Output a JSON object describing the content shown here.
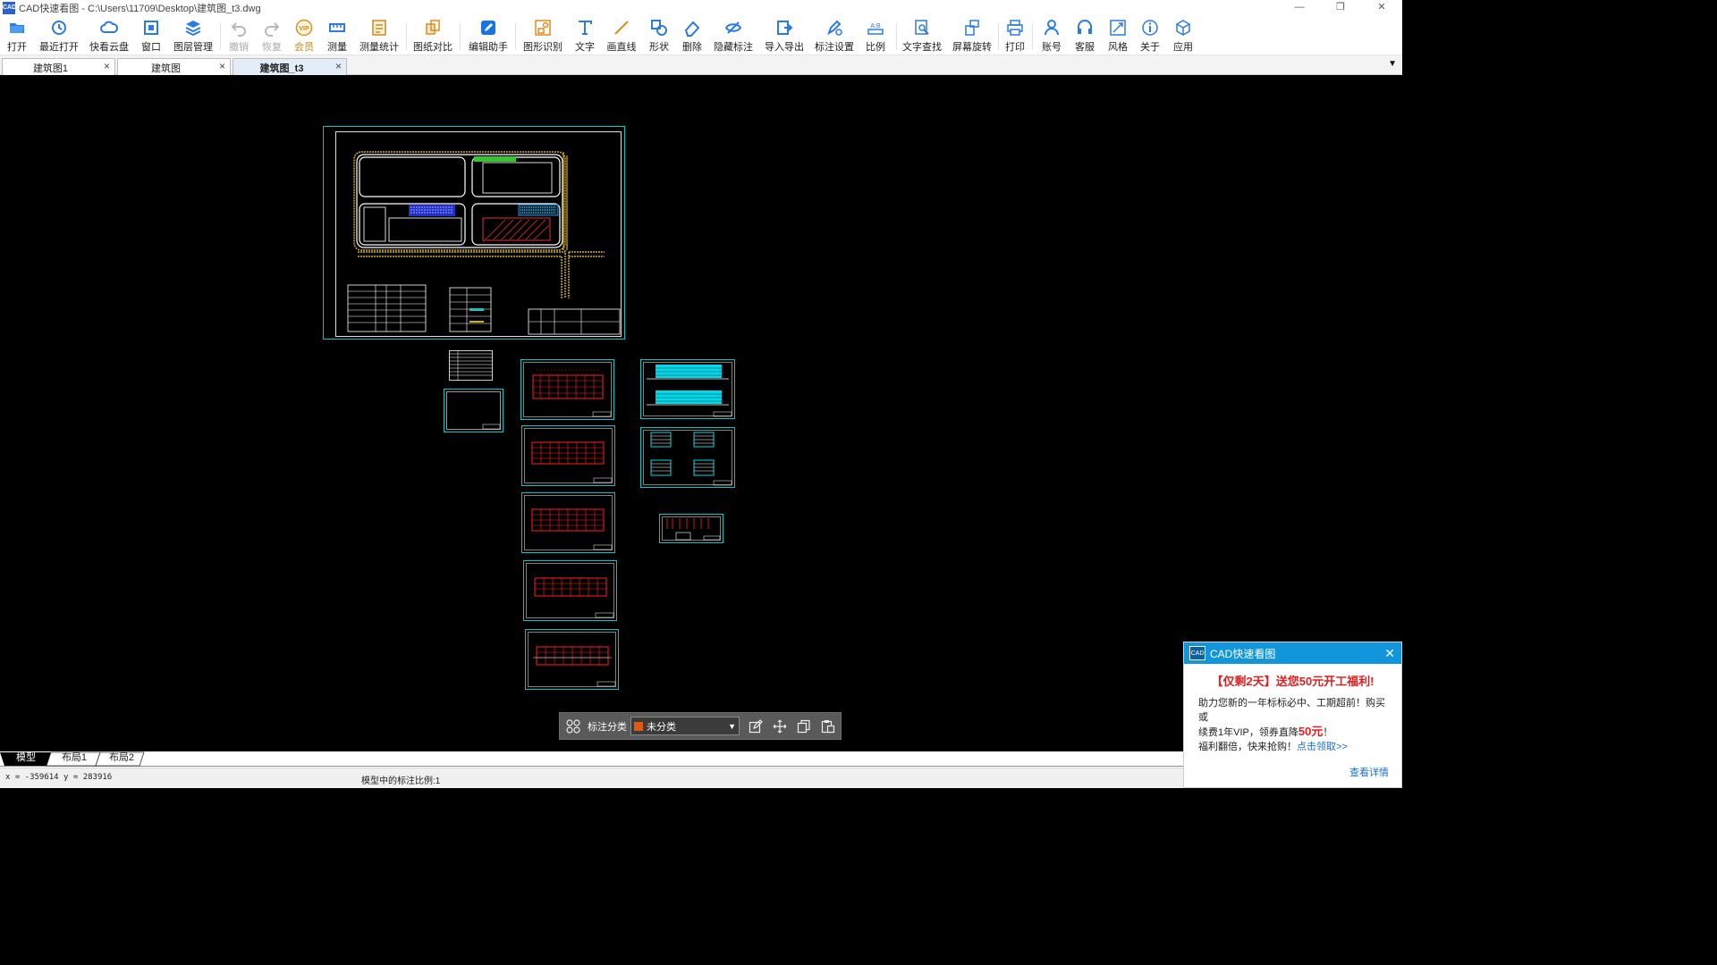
{
  "window": {
    "title": "CAD快速看图 - C:\\Users\\11709\\Desktop\\建筑图_t3.dwg",
    "app_icon_text": "CAD",
    "minimize": "—",
    "maximize": "❐",
    "close": "✕"
  },
  "toolbar": {
    "items": [
      {
        "id": "open",
        "label": "打开",
        "icon": "folder-open-icon"
      },
      {
        "id": "recent",
        "label": "最近打开",
        "icon": "history-icon"
      },
      {
        "id": "cloud",
        "label": "快看云盘",
        "icon": "cloud-icon"
      },
      {
        "id": "window",
        "label": "窗口",
        "icon": "window-fit-icon"
      },
      {
        "id": "layers",
        "label": "图层管理",
        "icon": "layers-icon"
      },
      {
        "id": "undo",
        "label": "撤销",
        "icon": "undo-icon",
        "disabled": true
      },
      {
        "id": "redo",
        "label": "恢复",
        "icon": "redo-icon",
        "disabled": true
      },
      {
        "id": "vip",
        "label": "会员",
        "icon": "vip-icon",
        "badge": "VIP"
      },
      {
        "id": "measure",
        "label": "测量",
        "icon": "ruler-icon"
      },
      {
        "id": "measure-stats",
        "label": "测量统计",
        "icon": "measure-stats-icon"
      },
      {
        "id": "compare",
        "label": "图纸对比",
        "icon": "compare-icon"
      },
      {
        "id": "edit-assistant",
        "label": "编辑助手",
        "icon": "edit-assistant-icon"
      },
      {
        "id": "shape-recognize",
        "label": "图形识别",
        "icon": "shape-recognize-icon"
      },
      {
        "id": "text",
        "label": "文字",
        "icon": "text-icon"
      },
      {
        "id": "line",
        "label": "画直线",
        "icon": "line-icon"
      },
      {
        "id": "shape",
        "label": "形状",
        "icon": "shape-icon"
      },
      {
        "id": "delete",
        "label": "删除",
        "icon": "eraser-icon"
      },
      {
        "id": "hide-annot",
        "label": "隐藏标注",
        "icon": "eye-hide-icon"
      },
      {
        "id": "import-export",
        "label": "导入导出",
        "icon": "import-export-icon"
      },
      {
        "id": "annot-settings",
        "label": "标注设置",
        "icon": "annotation-settings-icon"
      },
      {
        "id": "scale",
        "label": "比例",
        "icon": "scale-icon"
      },
      {
        "id": "text-search",
        "label": "文字查找",
        "icon": "text-search-icon"
      },
      {
        "id": "rotate",
        "label": "屏幕旋转",
        "icon": "rotate-icon"
      },
      {
        "id": "print",
        "label": "打印",
        "icon": "printer-icon"
      },
      {
        "id": "account",
        "label": "账号",
        "icon": "user-icon"
      },
      {
        "id": "support",
        "label": "客服",
        "icon": "headset-icon"
      },
      {
        "id": "style",
        "label": "风格",
        "icon": "style-icon"
      },
      {
        "id": "about",
        "label": "关于",
        "icon": "info-icon"
      },
      {
        "id": "apps",
        "label": "应用",
        "icon": "cube-icon"
      }
    ]
  },
  "tabs": [
    {
      "label": "建筑图1",
      "active": false,
      "close": "×"
    },
    {
      "label": "建筑图",
      "active": false,
      "close": "×"
    },
    {
      "label": "建筑图_t3",
      "active": true,
      "close": "×"
    }
  ],
  "tab_menu_glyph": "▼",
  "annotation_bar": {
    "label": "标注分类",
    "selected": "未分类",
    "swatch_color": "#e05a14"
  },
  "layout_tabs": [
    {
      "label": "模型",
      "active": true
    },
    {
      "label": "布局1",
      "active": false
    },
    {
      "label": "布局2",
      "active": false
    }
  ],
  "status": {
    "coords": "x = -359614  y = 283916",
    "annotation_scale": "模型中的标注比例:1"
  },
  "popup": {
    "logo": "CAD",
    "title": "CAD快速看图",
    "close": "✕",
    "headline": "【仅剩2天】送您50元开工福利!",
    "line1": "助力您新的一年标标必中、工期超前！购买或",
    "line2_prefix": "续费1年VIP，领券直降",
    "amount": "50元",
    "line2_suffix": "！",
    "line3_prefix": "福利翻倍，快来抢购！",
    "link": "点击领取>>",
    "more": "查看详情"
  },
  "colors": {
    "accent": "#1296db",
    "drawing_frame": "#00c8c8",
    "drawing_red": "#ff2020",
    "canvas": "#000000"
  }
}
